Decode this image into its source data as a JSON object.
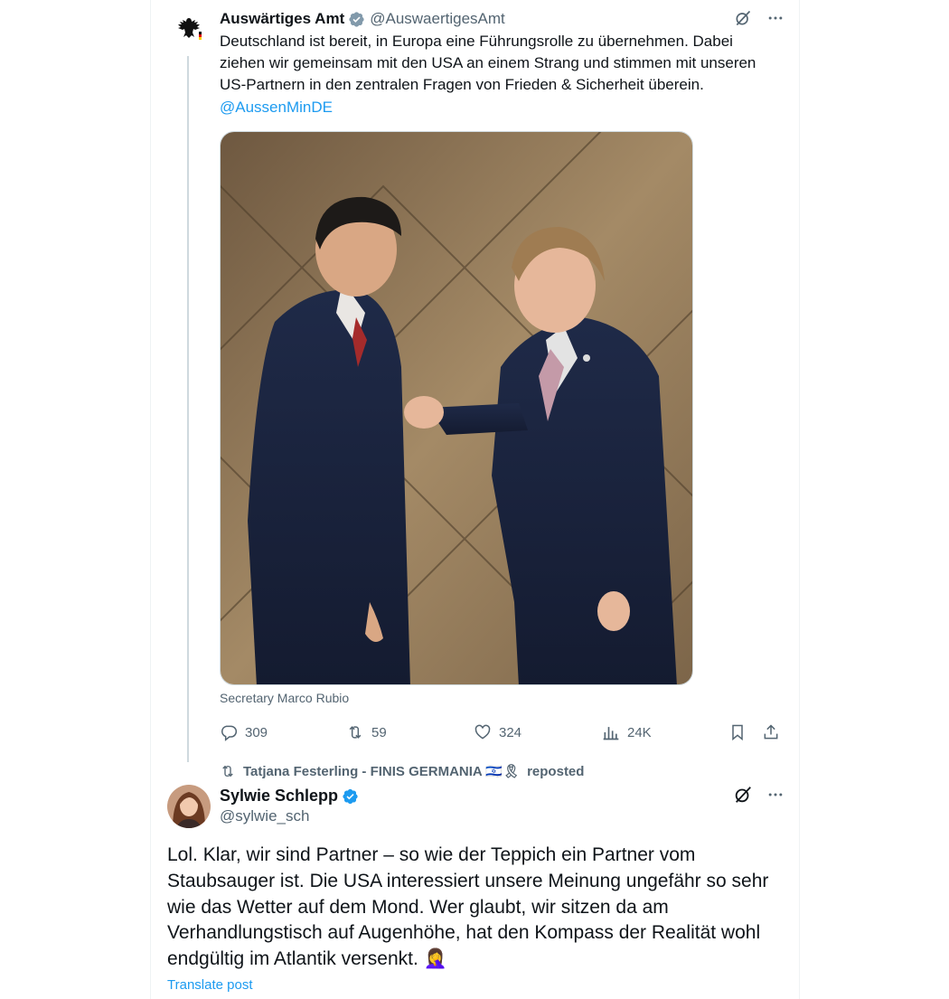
{
  "tweet1": {
    "author_name": "Auswärtiges Amt",
    "author_handle": "@AuswaertigesAmt",
    "text": "Deutschland ist bereit, in Europa eine Führungsrolle zu übernehmen. Dabei ziehen wir gemeinsam mit den USA an einem Strang und stimmen mit unseren US-Partnern in den zentralen Fragen von Frieden & Sicherheit überein.",
    "mention": "@AussenMinDE",
    "media_caption": "Secretary Marco Rubio",
    "stats": {
      "replies": "309",
      "reposts": "59",
      "likes": "324",
      "views": "24K"
    }
  },
  "repost_banner": {
    "text": "Tatjana Festerling - FINIS GERMANIA 🇮🇱🎗",
    "suffix": "reposted"
  },
  "tweet2": {
    "author_name": "Sylwie Schlepp",
    "author_handle": "@sylwie_sch",
    "text": "Lol. Klar, wir sind Partner – so wie der Teppich ein Partner vom Staubsauger ist. Die USA interessiert unsere Meinung ungefähr so sehr wie das Wetter auf dem Mond. Wer glaubt, wir sitzen da am Verhandlungstisch auf Augenhöhe, hat den Kompass der Realität wohl endgültig im Atlantik versenkt. 🤦‍♀️",
    "translate_label": "Translate post"
  },
  "icons": {
    "verified": "verified-badge-icon",
    "grok": "grok-icon",
    "more": "more-icon",
    "reply": "reply-icon",
    "repost": "repost-icon",
    "like": "heart-icon",
    "views": "views-icon",
    "bookmark": "bookmark-icon",
    "share": "share-icon"
  },
  "colors": {
    "accent": "#1d9bf0",
    "secondary_text": "#536471",
    "primary_text": "#0f1419"
  }
}
